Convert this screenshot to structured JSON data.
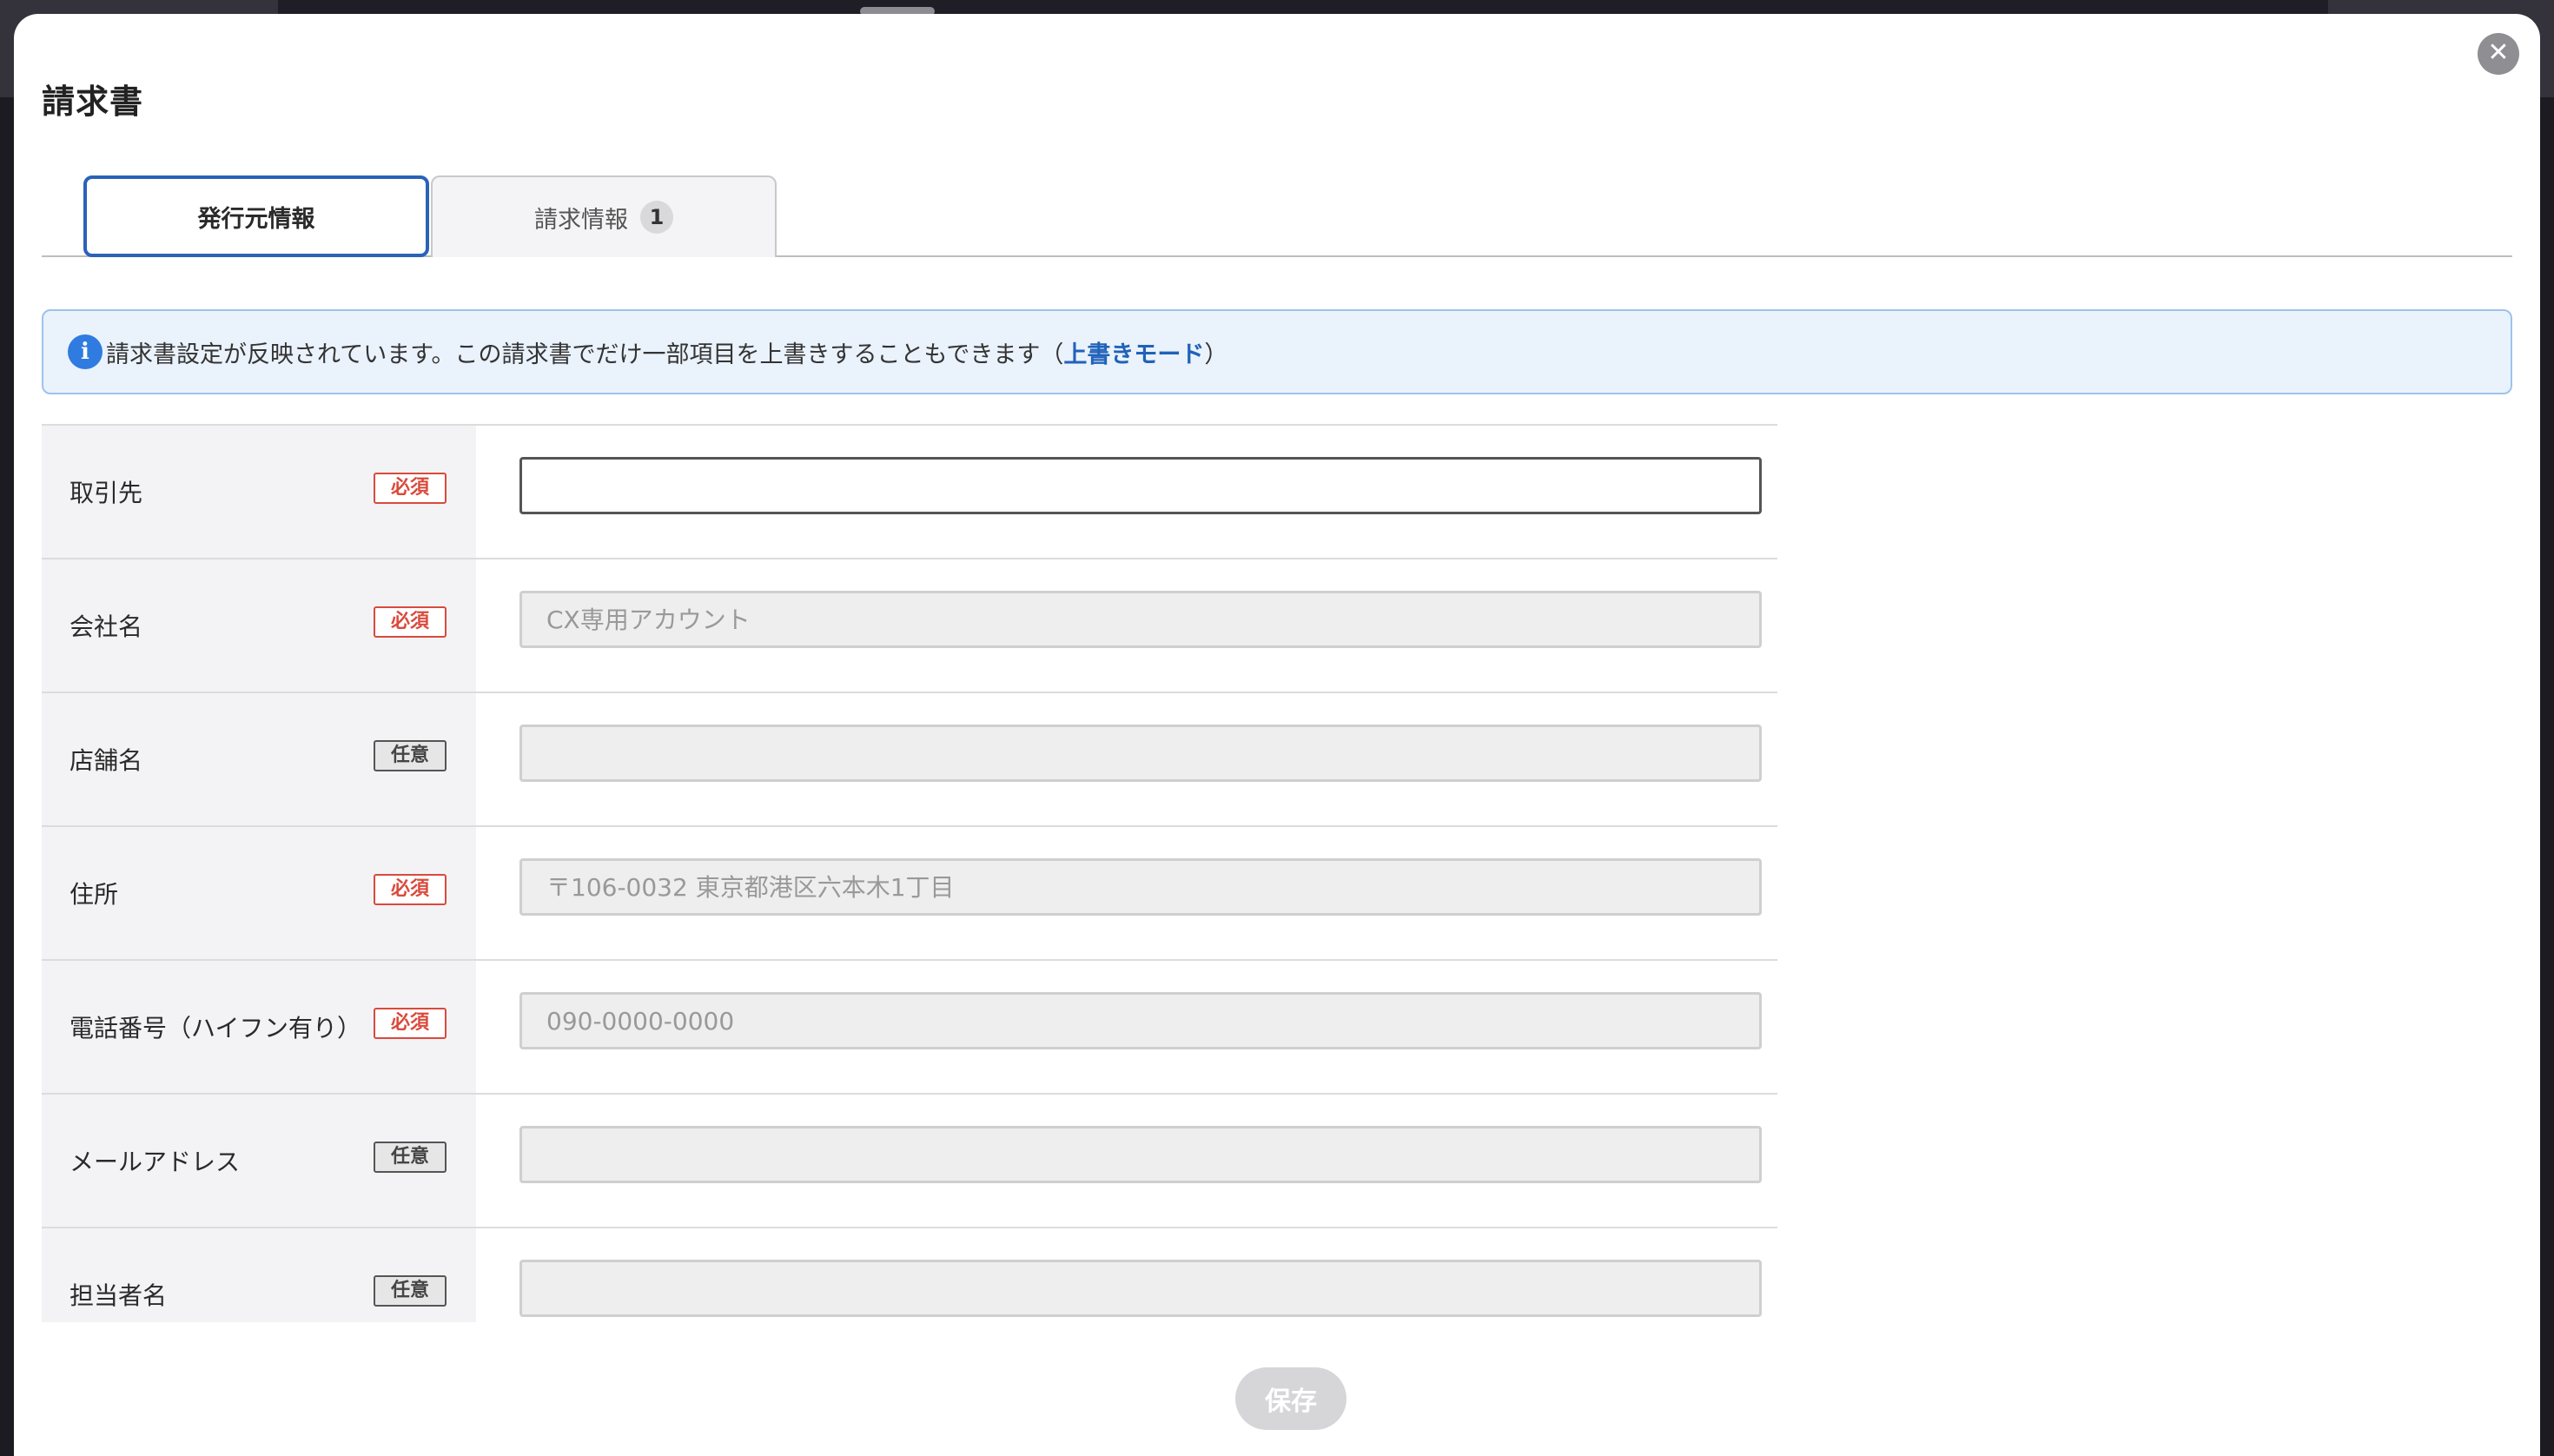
{
  "modal": {
    "title": "請求書",
    "close_symbol": "✕"
  },
  "tabs": [
    {
      "label": "発行元情報",
      "active": true
    },
    {
      "label": "請求情報",
      "badge": "1",
      "active": false
    }
  ],
  "info": {
    "icon": "i",
    "message": "請求書設定が反映されています。この請求書でだけ一部項目を上書きすることもできます（",
    "link_label": "上書きモード",
    "suffix": "）"
  },
  "form": {
    "rows": [
      {
        "label": "取引先",
        "badge": "必須",
        "badge_type": "required",
        "value": "",
        "placeholder": ""
      },
      {
        "label": "会社名",
        "badge": "必須",
        "badge_type": "required",
        "value": "",
        "placeholder": "CX専用アカウント"
      },
      {
        "label": "店舗名",
        "badge": "任意",
        "badge_type": "optional",
        "value": "",
        "placeholder": ""
      },
      {
        "label": "住所",
        "badge": "必須",
        "badge_type": "required",
        "value": "",
        "placeholder": "〒106-0032 東京都港区六本木1丁目"
      },
      {
        "label": "電話番号（ハイフン有り）",
        "badge": "必須",
        "badge_type": "required",
        "value": "",
        "placeholder": "090-0000-0000"
      },
      {
        "label": "メールアドレス",
        "badge": "任意",
        "badge_type": "optional",
        "value": "",
        "placeholder": ""
      },
      {
        "label": "担当者名",
        "badge": "任意",
        "badge_type": "optional",
        "value": "",
        "placeholder": ""
      }
    ]
  },
  "save_label": "保存",
  "colors": {
    "accent": "#2a62b8",
    "required": "#d94a3c",
    "info_bg": "#eaf2fc",
    "info_icon": "#2f7be0"
  }
}
